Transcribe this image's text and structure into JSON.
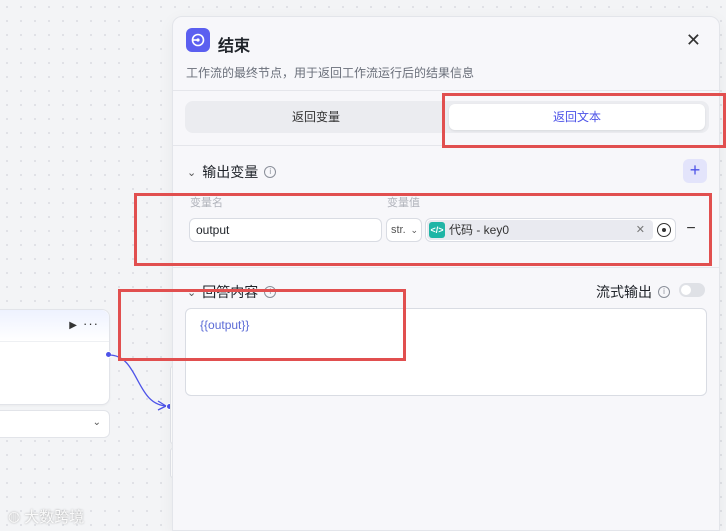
{
  "panel": {
    "title": "结束",
    "description": "工作流的最终节点，用于返回工作流运行后的结果信息",
    "close": "✕"
  },
  "tabs": [
    {
      "label": "返回变量",
      "selected": false
    },
    {
      "label": "返回文本",
      "selected": true
    }
  ],
  "output_section": {
    "title": "输出变量",
    "add_label": "+",
    "col_name": "变量名",
    "col_value": "变量值",
    "rows": [
      {
        "name": "output",
        "type": "str.",
        "ref_label": "代码 - key0",
        "remove_label": "−"
      }
    ]
  },
  "answer_section": {
    "title": "回答内容",
    "stream_label": "流式输出",
    "stream_enabled": false,
    "content": "{{output}}"
  },
  "canvas": {
    "node_run_icon": "▶",
    "node_more_icon": "···",
    "select_chevron": "⌄"
  },
  "watermark": "大数跨境",
  "colors": {
    "accent": "#4d53e8",
    "highlight": "#e14f4f",
    "code_node": "#1fb5a6"
  }
}
